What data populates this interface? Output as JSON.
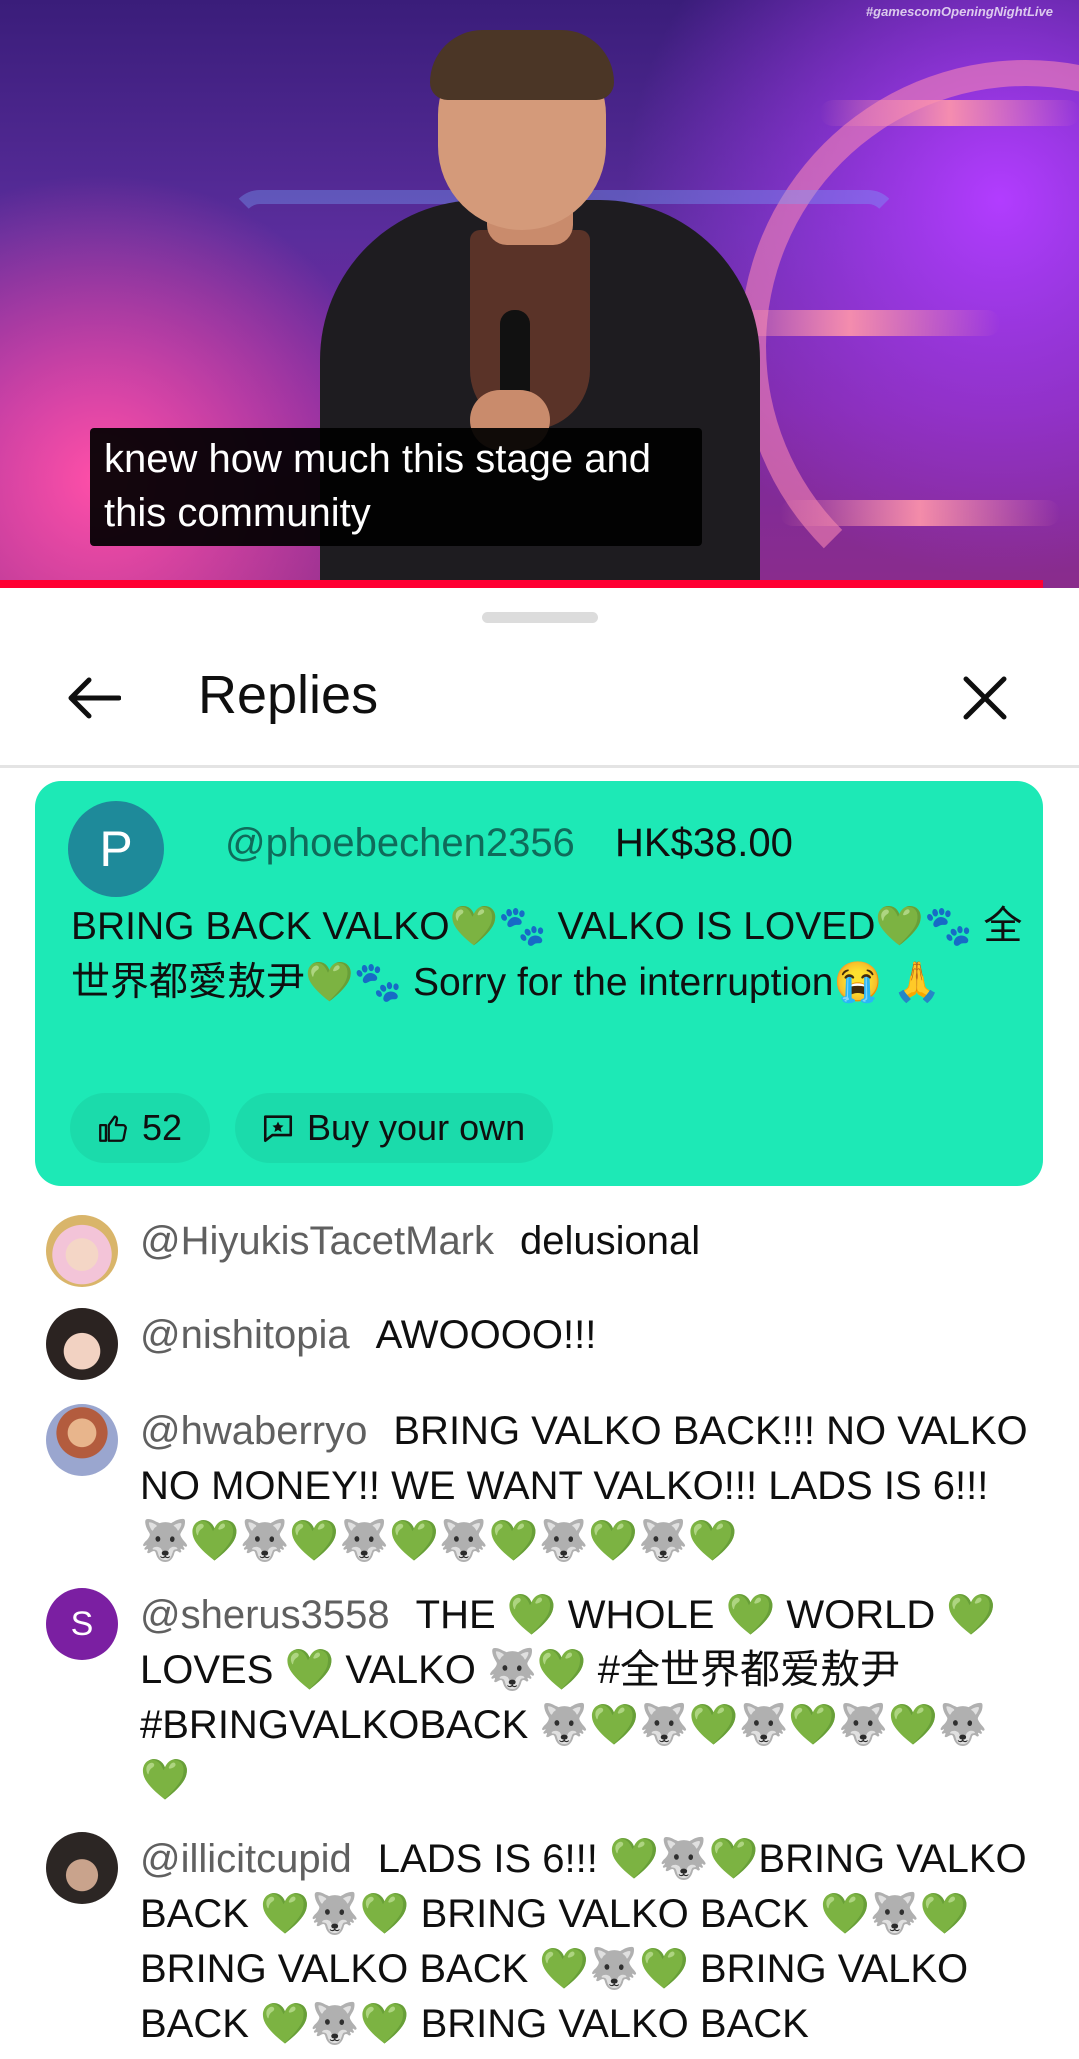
{
  "video": {
    "watermark": "#gamescomOpeningNightLive",
    "caption": "knew how much this stage and\nthis community",
    "accent_color": "#ff0033"
  },
  "sheet": {
    "title": "Replies",
    "back_icon": "arrow-left-icon",
    "close_icon": "close-icon"
  },
  "super_chat": {
    "avatar_letter": "P",
    "username": "@phoebechen2356",
    "amount": "HK$38.00",
    "text": "BRING BACK VALKO💚🐾 VALKO IS LOVED💚🐾 全世界都愛敖尹💚🐾 Sorry for the interruption😭 🙏",
    "likes": "52",
    "buy_label": "Buy your own",
    "background_color": "#1de9b6"
  },
  "replies": [
    {
      "username": "@HiyukisTacetMark",
      "text": "delusional",
      "avatar": "image"
    },
    {
      "username": "@nishitopia",
      "text": "AWOOOO!!!",
      "avatar": "image"
    },
    {
      "username": "@hwaberryo",
      "text": "BRING VALKO BACK!!! NO VALKO NO MONEY!! WE WANT VALKO!!! LADS IS 6!!! 🐺💚🐺💚🐺💚🐺💚🐺💚🐺💚",
      "avatar": "image"
    },
    {
      "username": "@sherus3558",
      "text": "THE 💚 WHOLE 💚 WORLD 💚 LOVES 💚 VALKO 🐺💚 #全世界都爱敖尹 #BRINGVALKOBACK 🐺💚🐺💚🐺💚🐺💚🐺 💚",
      "avatar": "S"
    },
    {
      "username": "@illicitcupid",
      "text": "LADS IS 6!!! 💚🐺💚BRING VALKO BACK 💚🐺💚 BRING VALKO BACK 💚🐺💚BRING VALKO BACK 💚🐺💚 BRING VALKO BACK 💚🐺💚 BRING VALKO BACK",
      "avatar": "image"
    }
  ]
}
